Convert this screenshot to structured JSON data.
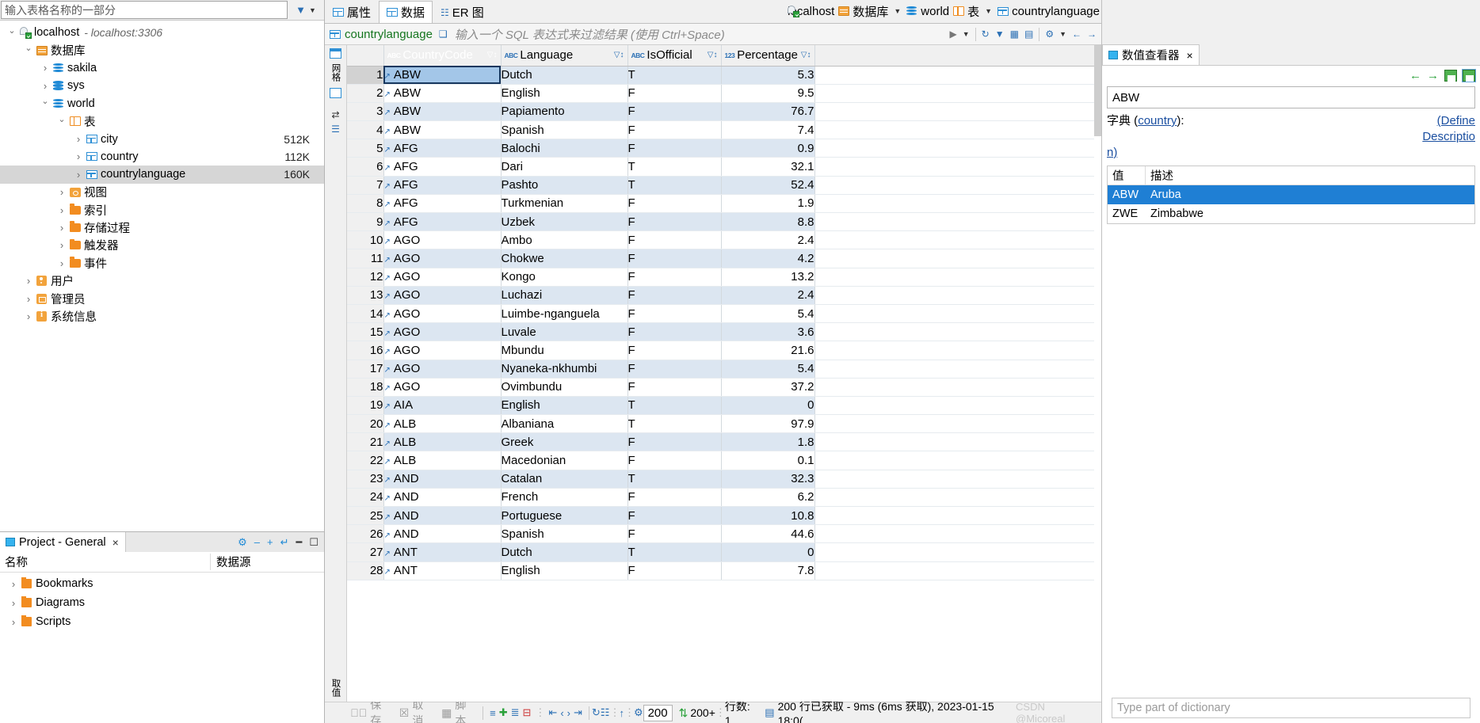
{
  "left": {
    "filter": {
      "placeholder": "输入表格名称的一部分",
      "value": ""
    },
    "filter_icons": {
      "filter": "filter-icon",
      "menu": "chevron-down-icon"
    },
    "tree": [
      {
        "indent": 0,
        "twisty": "open",
        "icon": "connection-icon",
        "label": "localhost",
        "sub": "- localhost:3306",
        "size": ""
      },
      {
        "indent": 1,
        "twisty": "open",
        "icon": "databases-icon",
        "label": "数据库",
        "sub": "",
        "size": ""
      },
      {
        "indent": 2,
        "twisty": "closed",
        "icon": "schema-icon",
        "label": "sakila",
        "sub": "",
        "size": ""
      },
      {
        "indent": 2,
        "twisty": "closed",
        "icon": "schema-icon",
        "label": "sys",
        "sub": "",
        "size": ""
      },
      {
        "indent": 2,
        "twisty": "open",
        "icon": "schema-icon",
        "label": "world",
        "sub": "",
        "size": ""
      },
      {
        "indent": 3,
        "twisty": "open",
        "icon": "tables-folder-icon",
        "label": "表",
        "sub": "",
        "size": ""
      },
      {
        "indent": 4,
        "twisty": "closed",
        "icon": "table-icon",
        "label": "city",
        "sub": "",
        "size": "512K"
      },
      {
        "indent": 4,
        "twisty": "closed",
        "icon": "table-icon",
        "label": "country",
        "sub": "",
        "size": "112K"
      },
      {
        "indent": 4,
        "twisty": "closed",
        "icon": "table-icon",
        "label": "countrylanguage",
        "sub": "",
        "size": "160K",
        "selected": true
      },
      {
        "indent": 3,
        "twisty": "closed",
        "icon": "view-icon",
        "label": "视图",
        "sub": "",
        "size": ""
      },
      {
        "indent": 3,
        "twisty": "closed",
        "icon": "folder-icon",
        "label": "索引",
        "sub": "",
        "size": ""
      },
      {
        "indent": 3,
        "twisty": "closed",
        "icon": "folder-icon",
        "label": "存储过程",
        "sub": "",
        "size": ""
      },
      {
        "indent": 3,
        "twisty": "closed",
        "icon": "folder-icon",
        "label": "触发器",
        "sub": "",
        "size": ""
      },
      {
        "indent": 3,
        "twisty": "closed",
        "icon": "folder-icon",
        "label": "事件",
        "sub": "",
        "size": ""
      },
      {
        "indent": 1,
        "twisty": "closed",
        "icon": "users-icon",
        "label": "用户",
        "sub": "",
        "size": ""
      },
      {
        "indent": 1,
        "twisty": "closed",
        "icon": "admin-icon",
        "label": "管理员",
        "sub": "",
        "size": ""
      },
      {
        "indent": 1,
        "twisty": "closed",
        "icon": "sysinfo-icon",
        "label": "系统信息",
        "sub": "",
        "size": ""
      }
    ],
    "project": {
      "tab_label": "Project - General",
      "tab_close": "×",
      "tools": [
        "gear-icon",
        "minimize-icon",
        "maximize-icon",
        "restore-icon",
        "collapse-icon",
        "panel-icon"
      ],
      "columns": [
        "名称",
        "数据源"
      ],
      "rows": [
        {
          "label": "Bookmarks",
          "datasource": "",
          "icon": "bookmarks-folder-icon"
        },
        {
          "label": "Diagrams",
          "datasource": "",
          "icon": "diagrams-folder-icon"
        },
        {
          "label": "Scripts",
          "datasource": "",
          "icon": "scripts-folder-icon"
        }
      ]
    }
  },
  "editor": {
    "tabs": [
      {
        "label": "属性",
        "icon": "properties-icon",
        "active": false
      },
      {
        "label": "数据",
        "icon": "data-icon",
        "active": true
      },
      {
        "label": "ER 图",
        "icon": "er-diagram-icon",
        "active": false
      }
    ],
    "breadcrumb": [
      {
        "label": "localhost",
        "icon": "connection-icon",
        "caret": false
      },
      {
        "label": "数据库",
        "icon": "databases-icon",
        "caret": true
      },
      {
        "label": "world",
        "icon": "schema-icon",
        "caret": false
      },
      {
        "label": "表",
        "icon": "tables-folder-icon",
        "caret": true
      },
      {
        "label": "countrylanguage",
        "icon": "table-icon",
        "caret": false
      }
    ],
    "filter_bar": {
      "table_name": "countrylanguage",
      "expand_icon": "expand-icon",
      "placeholder": "输入一个 SQL 表达式来过滤结果 (使用 Ctrl+Space)",
      "right_icons": [
        "play-icon",
        "chevron-down-icon",
        "history-icon",
        "filter-icon",
        "grid-icon",
        "columns-icon",
        "settings-icon",
        "prev-icon",
        "next-icon"
      ]
    },
    "side_strip": {
      "top_label": "网格",
      "bottom_label": "取值",
      "icons": [
        "grid-icon",
        "text-icon",
        "collapse-panel-icon",
        "expand-panel-icon"
      ]
    }
  },
  "grid": {
    "columns": [
      {
        "label": "",
        "type": "",
        "width": "rownum"
      },
      {
        "label": "CountryCode",
        "type": "ABC",
        "selected": true
      },
      {
        "label": "Language",
        "type": "ABC",
        "selected": false
      },
      {
        "label": "IsOfficial",
        "type": "ABC",
        "selected": false
      },
      {
        "label": "Percentage",
        "type": "123",
        "selected": false
      }
    ],
    "rows": [
      {
        "n": "1",
        "code": "ABW",
        "lang": "Dutch",
        "official": "T",
        "pct": "5.3",
        "sel": true
      },
      {
        "n": "2",
        "code": "ABW",
        "lang": "English",
        "official": "F",
        "pct": "9.5"
      },
      {
        "n": "3",
        "code": "ABW",
        "lang": "Papiamento",
        "official": "F",
        "pct": "76.7"
      },
      {
        "n": "4",
        "code": "ABW",
        "lang": "Spanish",
        "official": "F",
        "pct": "7.4"
      },
      {
        "n": "5",
        "code": "AFG",
        "lang": "Balochi",
        "official": "F",
        "pct": "0.9"
      },
      {
        "n": "6",
        "code": "AFG",
        "lang": "Dari",
        "official": "T",
        "pct": "32.1"
      },
      {
        "n": "7",
        "code": "AFG",
        "lang": "Pashto",
        "official": "T",
        "pct": "52.4"
      },
      {
        "n": "8",
        "code": "AFG",
        "lang": "Turkmenian",
        "official": "F",
        "pct": "1.9"
      },
      {
        "n": "9",
        "code": "AFG",
        "lang": "Uzbek",
        "official": "F",
        "pct": "8.8"
      },
      {
        "n": "10",
        "code": "AGO",
        "lang": "Ambo",
        "official": "F",
        "pct": "2.4"
      },
      {
        "n": "11",
        "code": "AGO",
        "lang": "Chokwe",
        "official": "F",
        "pct": "4.2"
      },
      {
        "n": "12",
        "code": "AGO",
        "lang": "Kongo",
        "official": "F",
        "pct": "13.2"
      },
      {
        "n": "13",
        "code": "AGO",
        "lang": "Luchazi",
        "official": "F",
        "pct": "2.4"
      },
      {
        "n": "14",
        "code": "AGO",
        "lang": "Luimbe-nganguela",
        "official": "F",
        "pct": "5.4"
      },
      {
        "n": "15",
        "code": "AGO",
        "lang": "Luvale",
        "official": "F",
        "pct": "3.6"
      },
      {
        "n": "16",
        "code": "AGO",
        "lang": "Mbundu",
        "official": "F",
        "pct": "21.6"
      },
      {
        "n": "17",
        "code": "AGO",
        "lang": "Nyaneka-nkhumbi",
        "official": "F",
        "pct": "5.4"
      },
      {
        "n": "18",
        "code": "AGO",
        "lang": "Ovimbundu",
        "official": "F",
        "pct": "37.2"
      },
      {
        "n": "19",
        "code": "AIA",
        "lang": "English",
        "official": "T",
        "pct": "0"
      },
      {
        "n": "20",
        "code": "ALB",
        "lang": "Albaniana",
        "official": "T",
        "pct": "97.9"
      },
      {
        "n": "21",
        "code": "ALB",
        "lang": "Greek",
        "official": "F",
        "pct": "1.8"
      },
      {
        "n": "22",
        "code": "ALB",
        "lang": "Macedonian",
        "official": "F",
        "pct": "0.1"
      },
      {
        "n": "23",
        "code": "AND",
        "lang": "Catalan",
        "official": "T",
        "pct": "32.3"
      },
      {
        "n": "24",
        "code": "AND",
        "lang": "French",
        "official": "F",
        "pct": "6.2"
      },
      {
        "n": "25",
        "code": "AND",
        "lang": "Portuguese",
        "official": "F",
        "pct": "10.8"
      },
      {
        "n": "26",
        "code": "AND",
        "lang": "Spanish",
        "official": "F",
        "pct": "44.6"
      },
      {
        "n": "27",
        "code": "ANT",
        "lang": "Dutch",
        "official": "T",
        "pct": "0"
      },
      {
        "n": "28",
        "code": "ANT",
        "lang": "English",
        "official": "F",
        "pct": "7.8"
      }
    ]
  },
  "status": {
    "save": "保存",
    "cancel": "取消",
    "script": "脚本",
    "icons": [
      "apply-icon",
      "cancel-icon",
      "script-icon",
      "edit-row-icon",
      "add-row-icon",
      "duplicate-row-icon",
      "delete-row-icon",
      "first-page-icon",
      "prev-page-icon",
      "next-page-icon",
      "last-page-icon",
      "refresh-icon",
      "fit-icon",
      "export-icon",
      "settings-icon"
    ],
    "fetch_size": "200",
    "more_rows": "200+",
    "row_label": "行数: 1",
    "fetch_info": "200 行已获取 - 9ms (6ms 获取), 2023-01-15 18:0(",
    "watermark": "CSDN @Micoreal"
  },
  "value_panel": {
    "tab_label": "数值查看器",
    "tab_close": "×",
    "tools": [
      "back-arrow-icon",
      "forward-arrow-icon",
      "save-icon",
      "save-as-icon"
    ],
    "value": "ABW",
    "dict_label": "字典",
    "dict_link_table": "country",
    "dict_colon": ":",
    "dict_desc_open": "(Define",
    "dict_desc_link": "Descriptio",
    "dict_desc_tail": "n)",
    "columns": [
      "值",
      "描述"
    ],
    "rows": [
      {
        "value": "ABW",
        "desc": "Aruba",
        "selected": true
      },
      {
        "value": "ZWE",
        "desc": "Zimbabwe",
        "selected": false
      }
    ],
    "search_placeholder": "Type part of dictionary"
  }
}
